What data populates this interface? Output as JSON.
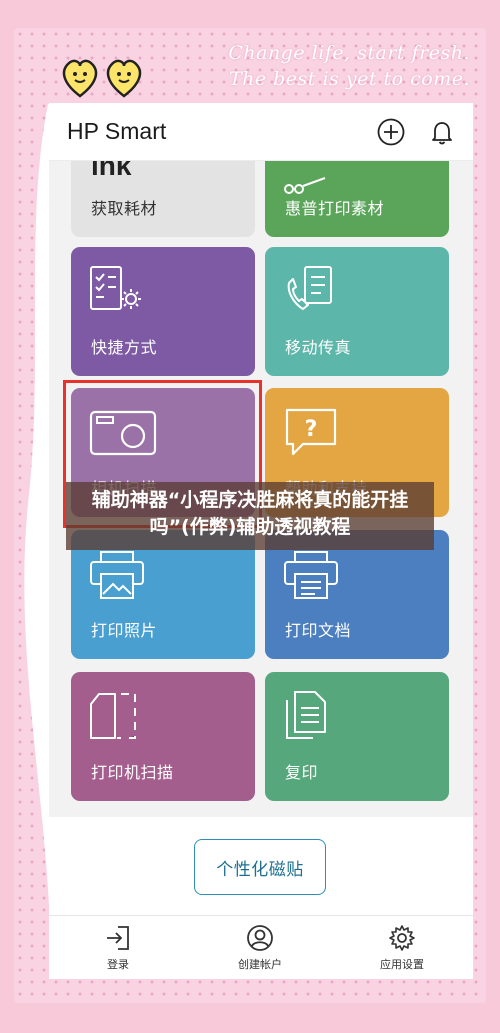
{
  "decor": {
    "tagline_line1": "Change life, start fresh.",
    "tagline_line2": "The best is yet to come."
  },
  "header": {
    "title": "HP Smart",
    "add_icon": "plus-circle-icon",
    "bell_icon": "bell-icon"
  },
  "tiles": [
    {
      "label": "获取耗材",
      "partial_text": "ink",
      "icon": "ink-icon"
    },
    {
      "label": "惠普打印素材",
      "icon": "print-material-icon"
    },
    {
      "label": "快捷方式",
      "icon": "shortcut-checklist-icon"
    },
    {
      "label": "移动传真",
      "icon": "mobile-fax-icon"
    },
    {
      "label": "相机扫描",
      "icon": "camera-icon"
    },
    {
      "label": "帮助和支持",
      "icon": "help-question-icon"
    },
    {
      "label": "打印照片",
      "icon": "print-photo-icon"
    },
    {
      "label": "打印文档",
      "icon": "print-document-icon"
    },
    {
      "label": "打印机扫描",
      "icon": "printer-scan-icon"
    },
    {
      "label": "复印",
      "icon": "copy-icon"
    }
  ],
  "custom_button": "个性化磁贴",
  "bottom_nav": [
    {
      "label": "登录",
      "icon": "sign-in-icon"
    },
    {
      "label": "创建帐户",
      "icon": "account-icon"
    },
    {
      "label": "应用设置",
      "icon": "settings-gear-icon"
    }
  ],
  "overlay_title": "辅助神器“小程序决胜麻将真的能开挂吗”(作弊)辅助透视教程",
  "colors": {
    "background_pink": "#f9d3e1",
    "highlight_red": "#e8322b",
    "accent_teal": "#2b8fb7"
  }
}
